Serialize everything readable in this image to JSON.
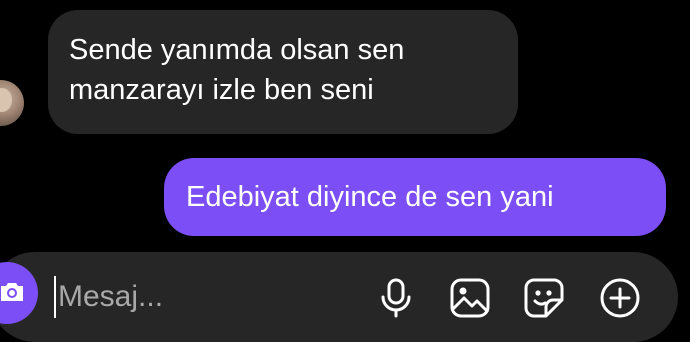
{
  "thread": {
    "messages": [
      {
        "direction": "incoming",
        "text": "Sende yanımda olsan sen\nmanzarayı izle ben seni"
      },
      {
        "direction": "outgoing",
        "text": "Edebiyat diyince de sen yani"
      }
    ]
  },
  "composer": {
    "placeholder": "Mesaj...",
    "value": "",
    "icons": [
      "camera-icon",
      "microphone-icon",
      "image-icon",
      "sticker-icon",
      "add-icon"
    ]
  },
  "colors": {
    "background": "#000000",
    "incoming_bubble": "#262626",
    "outgoing_bubble": "#7b4ff5",
    "composer": "#262626",
    "placeholder": "#a8a8a8"
  }
}
